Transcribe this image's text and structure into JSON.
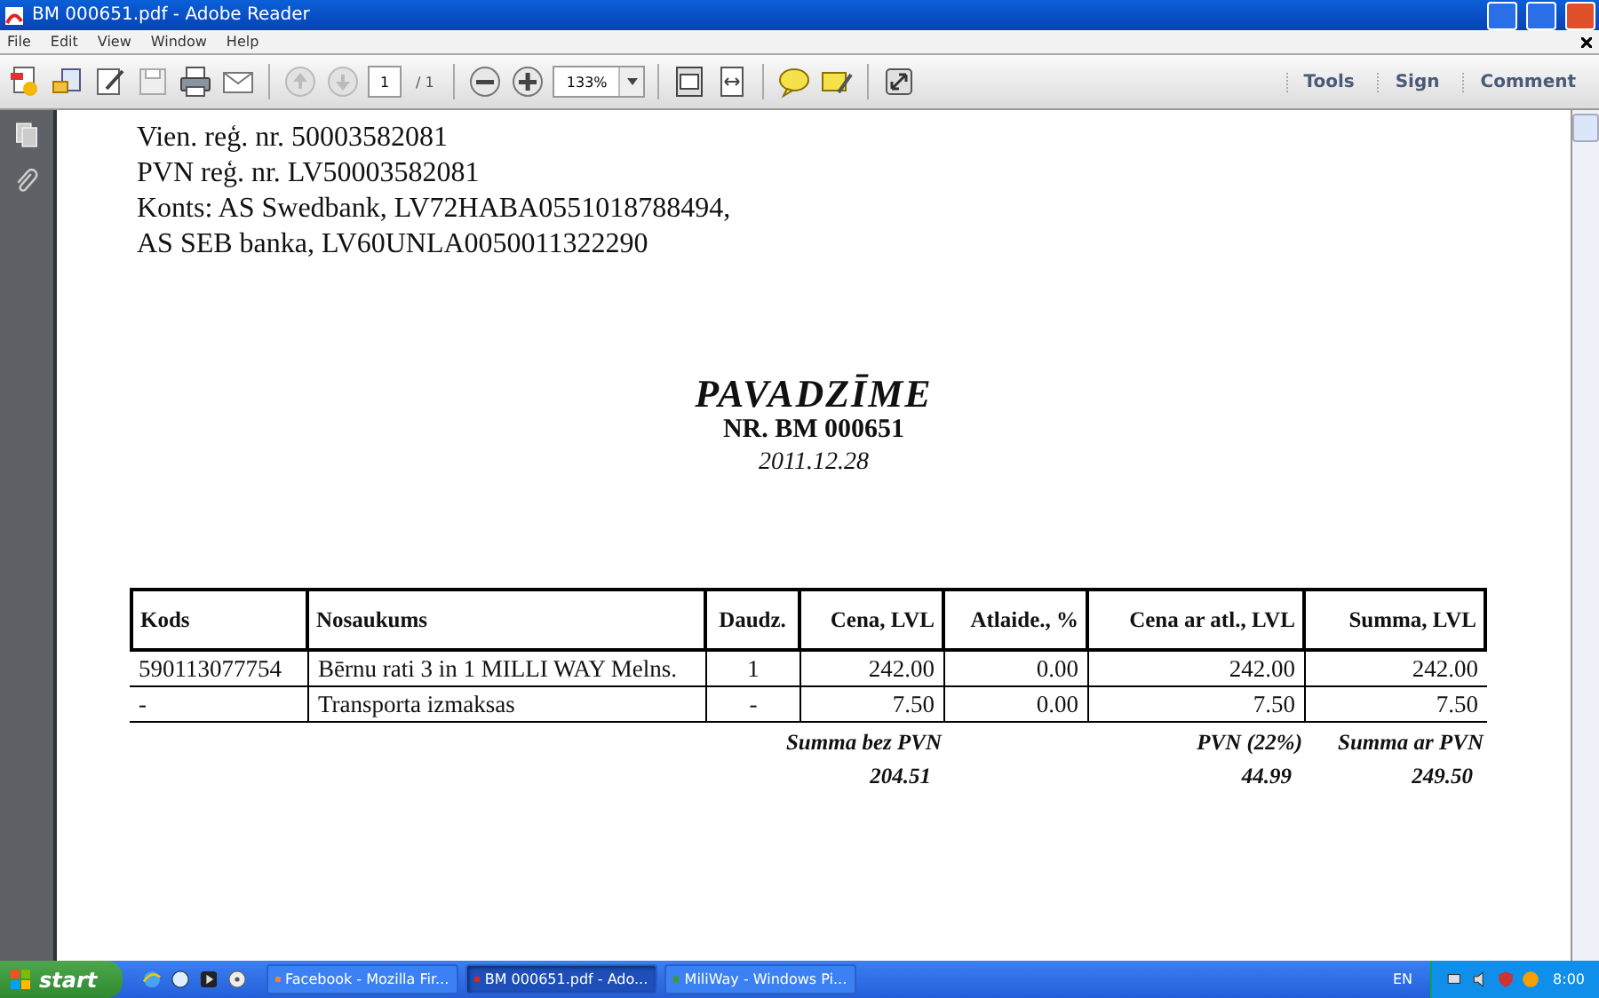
{
  "window": {
    "title": "BM 000651.pdf - Adobe Reader"
  },
  "menu": [
    "File",
    "Edit",
    "View",
    "Window",
    "Help"
  ],
  "toolbar": {
    "page_current": "1",
    "page_total": "/ 1",
    "zoom": "133%",
    "panels": [
      "Tools",
      "Sign",
      "Comment"
    ]
  },
  "document": {
    "address_lines": [
      "Vien. reģ. nr. 50003582081",
      "PVN reģ. nr. LV50003582081",
      "Konts: AS Swedbank, LV72HABA0551018788494,",
      "AS SEB banka, LV60UNLA0050011322290"
    ],
    "title": "PAVADZĪME",
    "number": "NR. BM 000651",
    "date": "2011.12.28",
    "table": {
      "columns": [
        "Kods",
        "Nosaukums",
        "Daudz.",
        "Cena, LVL",
        "Atlaide., %",
        "Cena ar atl., LVL",
        "Summa, LVL"
      ],
      "rows": [
        [
          "590113077754",
          "Bērnu rati 3 in 1 MILLI WAY Melns.",
          "1",
          "242.00",
          "0.00",
          "242.00",
          "242.00"
        ],
        [
          "-",
          "Transporta izmaksas",
          "-",
          "7.50",
          "0.00",
          "7.50",
          "7.50"
        ]
      ]
    },
    "totals": [
      {
        "label": "Summa bez PVN",
        "value": "204.51"
      },
      {
        "label": "PVN (22%)",
        "value": "44.99"
      },
      {
        "label": "Summa ar PVN",
        "value": "249.50"
      }
    ]
  },
  "taskbar": {
    "start": "start",
    "tasks": [
      {
        "label": "Facebook - Mozilla Fir...",
        "selected": false
      },
      {
        "label": "BM 000651.pdf - Ado...",
        "selected": true
      },
      {
        "label": "MiliWay - Windows Pi...",
        "selected": false
      }
    ],
    "language": "EN",
    "clock": "8:00"
  }
}
